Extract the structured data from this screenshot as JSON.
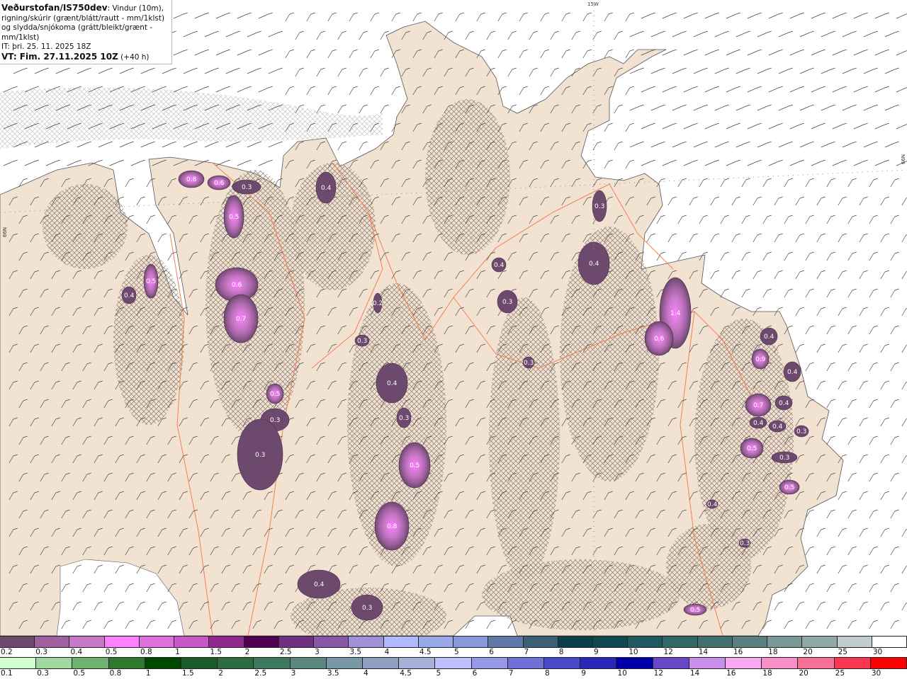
{
  "header": {
    "source": "Veðurstofan/IS750dev",
    "description": ": Vindur (10m), rigning/skúrir (grænt/blátt/rautt - mm/1klst) og slydda/snjókoma (grátt/bleikt/grænt - mm/1klst)",
    "issue_time": "IT: þri. 25. 11. 2025 18Z",
    "valid_time": "VT: Fim. 27.11.2025 10Z",
    "lead_time": " (+40 h)"
  },
  "map": {
    "longitude_label": "15W",
    "latitude_label_left": "66N",
    "latitude_label_right": "66N",
    "colors": {
      "sea": "#ffffff",
      "land": "#f2e2d2",
      "roads": "#f08050",
      "hatch": "#8a7a70"
    },
    "precip_values": [
      "0.8",
      "0.6",
      "0.3",
      "0.5",
      "0.6",
      "0.7",
      "0.5",
      "0.3",
      "0.3",
      "0.4",
      "0.5",
      "0.4",
      "0.2",
      "0.3",
      "0.4",
      "0.3",
      "0.5",
      "0.8",
      "0.4",
      "0.3",
      "0.3",
      "0.4",
      "0.4",
      "0.3",
      "0.3",
      "1.4",
      "0.6",
      "0.4",
      "0.9",
      "0.4",
      "0.7",
      "0.4",
      "0.4",
      "0.4",
      "0.3",
      "0.5",
      "0.3",
      "0.5",
      "0.4",
      "0.3",
      "0.5"
    ]
  },
  "legend_snow": {
    "labels": [
      "0.2",
      "0.3",
      "0.4",
      "0.5",
      "0.8",
      "1",
      "1.5",
      "2",
      "2.5",
      "3",
      "3.5",
      "4",
      "4.5",
      "5",
      "6",
      "7",
      "8",
      "9",
      "10",
      "12",
      "14",
      "16",
      "18",
      "20",
      "25",
      "30"
    ],
    "colors": [
      "#6d4a6d",
      "#a060a0",
      "#c878c8",
      "#ff80ff",
      "#e070e0",
      "#c858c8",
      "#902890",
      "#500050",
      "#703080",
      "#8858a8",
      "#a090d8",
      "#b0b8ff",
      "#98a8e8",
      "#8898d8",
      "#6078a8",
      "#386078",
      "#0a4048",
      "#104850",
      "#205860",
      "#306868",
      "#407070",
      "#588080",
      "#789898",
      "#90a8a8",
      "#c0ccd0",
      "#ffffff"
    ]
  },
  "legend_rain": {
    "labels": [
      "0.1",
      "0.3",
      "0.5",
      "0.8",
      "1",
      "1.5",
      "2",
      "2.5",
      "3",
      "3.5",
      "4",
      "4.5",
      "5",
      "6",
      "7",
      "8",
      "9",
      "10",
      "12",
      "14",
      "16",
      "18",
      "20",
      "25",
      "30"
    ],
    "colors": [
      "#d0ffd0",
      "#a0d8a0",
      "#70b070",
      "#307830",
      "#004800",
      "#1c5a28",
      "#2e6a40",
      "#3e7860",
      "#5a8880",
      "#7898a8",
      "#90a0c0",
      "#a8b0d8",
      "#c0c0ff",
      "#9898e8",
      "#7070d8",
      "#4848c8",
      "#2828b8",
      "#0000a8",
      "#6848c8",
      "#c890e8",
      "#f8a8f0",
      "#f890c8",
      "#f87098",
      "#f83850",
      "#ff0000"
    ]
  }
}
